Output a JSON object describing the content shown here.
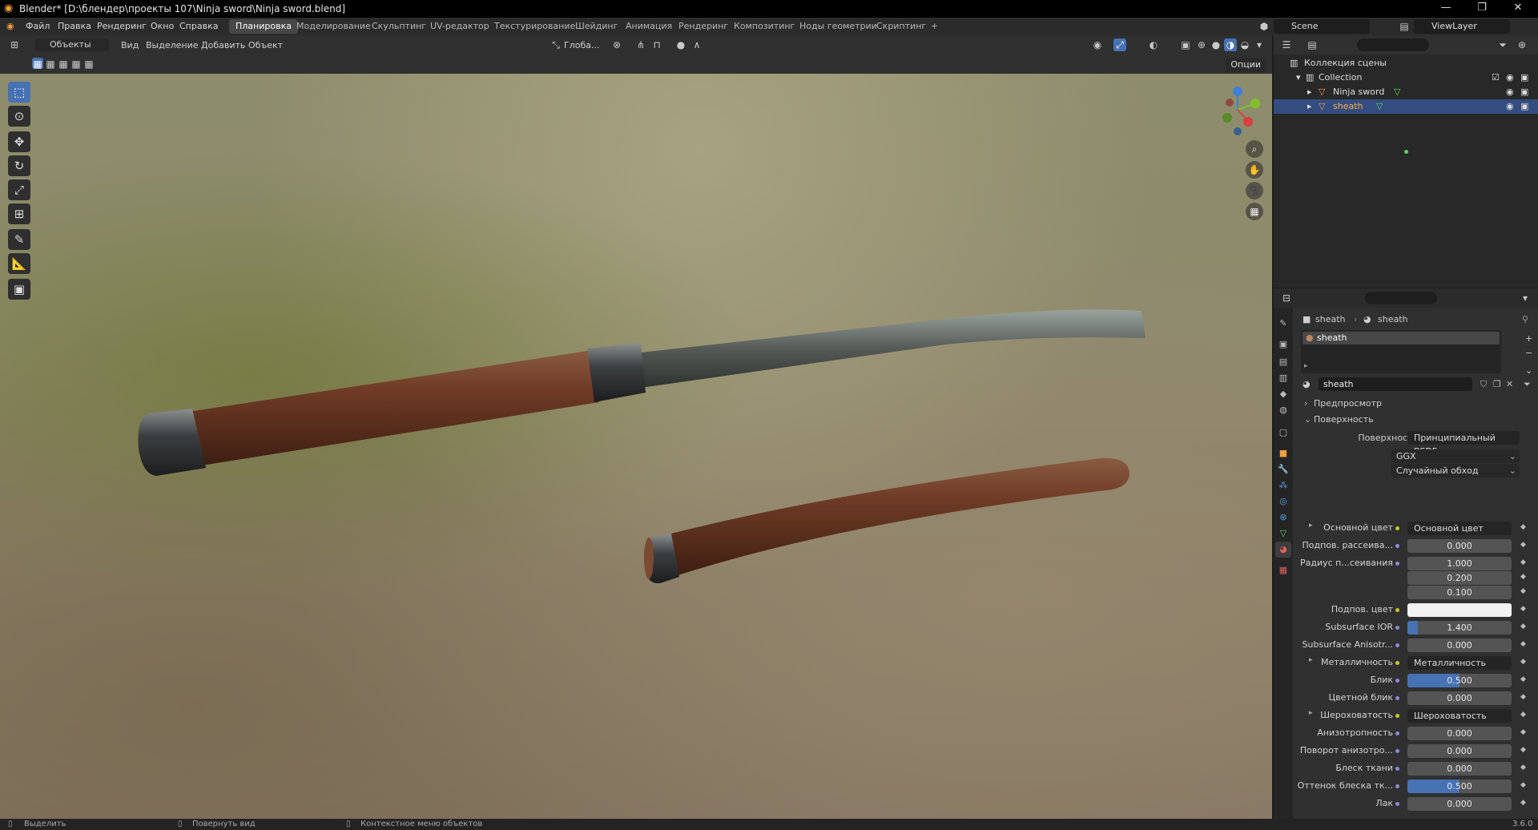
{
  "window": {
    "title": "Blender* [D:\\блендер\\проекты 107\\Ninja sword\\Ninja sword.blend]"
  },
  "menu": {
    "items": [
      "Файл",
      "Правка",
      "Рендеринг",
      "Окно",
      "Справка"
    ],
    "workspaces": [
      "Планировка",
      "Моделирование",
      "Скульптинг",
      "UV-редактор",
      "Текстурирование",
      "Шейдинг",
      "Анимация",
      "Рендеринг",
      "Композитинг",
      "Ноды геометрии",
      "Скриптинг",
      "+"
    ],
    "active_workspace": "Планировка",
    "scene": "Scene",
    "view_layer": "ViewLayer"
  },
  "viewport_header": {
    "mode": "Объекты",
    "menus": [
      "Вид",
      "Выделение",
      "Добавить",
      "Объект"
    ],
    "transform": "Глоба...",
    "options": "Опции"
  },
  "outliner": {
    "root": "Коллекция сцены",
    "items": [
      {
        "label": "Collection"
      },
      {
        "label": "Ninja sword"
      },
      {
        "label": "sheath"
      }
    ]
  },
  "properties": {
    "breadcrumb_object": "sheath",
    "breadcrumb_material": "sheath",
    "material_slot": "sheath",
    "material_name": "sheath",
    "panels": {
      "preview": "Предпросмотр",
      "surface": "Поверхность"
    },
    "surface_label": "Поверхность",
    "surface_shader": "Принципиальный BSDF",
    "distribution": "GGX",
    "subsurface_method": "Случайный обход",
    "rows": [
      {
        "label": "Основной цвет",
        "link": "Основной цвет"
      },
      {
        "label": "Подпов. рассеива...",
        "value": "0.000",
        "fill": 0
      },
      {
        "label": "Радиус п...сеивания",
        "value": "1.000",
        "fill": 0
      },
      {
        "label": "",
        "value": "0.200",
        "fill": 0
      },
      {
        "label": "",
        "value": "0.100",
        "fill": 0
      },
      {
        "label": "Подпов. цвет",
        "color": "#f2f2f2"
      },
      {
        "label": "Subsurface IOR",
        "value": "1.400",
        "fill": 0.1
      },
      {
        "label": "Subsurface Anisotr...",
        "value": "0.000",
        "fill": 0
      },
      {
        "label": "Металличность",
        "link": "Металличность"
      },
      {
        "label": "Блик",
        "value": "0.500",
        "fill": 0.5
      },
      {
        "label": "Цветной блик",
        "value": "0.000",
        "fill": 0
      },
      {
        "label": "Шероховатость",
        "link": "Шероховатость"
      },
      {
        "label": "Анизотропность",
        "value": "0.000",
        "fill": 0
      },
      {
        "label": "Поворот анизотро...",
        "value": "0.000",
        "fill": 0
      },
      {
        "label": "Блеск ткани",
        "value": "0.000",
        "fill": 0
      },
      {
        "label": "Оттенок блеска тк...",
        "value": "0.500",
        "fill": 0.5
      },
      {
        "label": "Лак",
        "value": "0.000",
        "fill": 0
      }
    ]
  },
  "statusbar": {
    "select": "Выделить",
    "rotate": "Повернуть вид",
    "context": "Контекстное меню объектов",
    "version": "3.6.0"
  },
  "colors": {
    "accent": "#4772b3",
    "selected_row": "#334d80",
    "wood": "#6e3b26",
    "metal": "#4c4f52"
  }
}
